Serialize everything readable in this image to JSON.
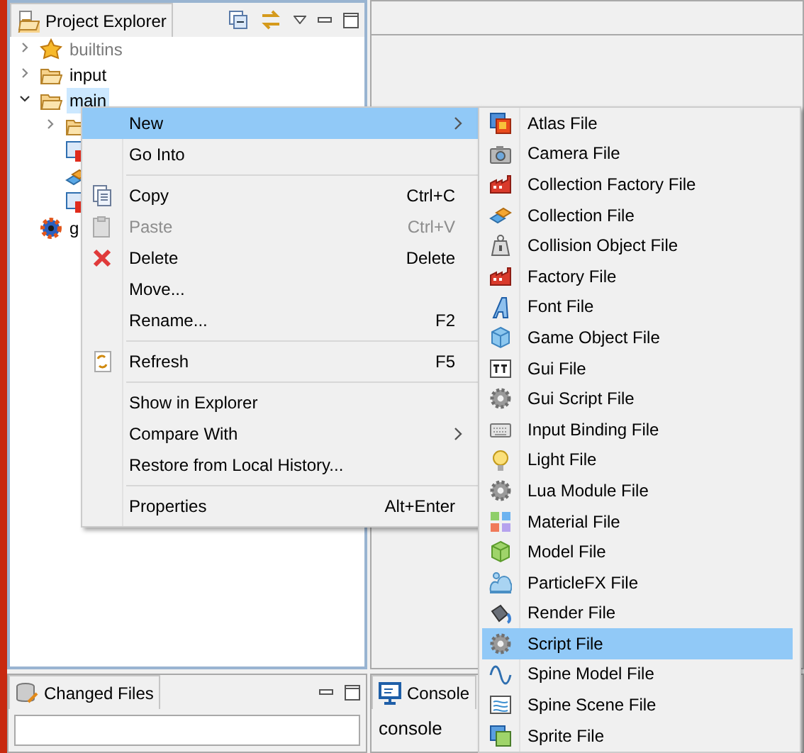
{
  "project_explorer": {
    "tab": {
      "label": "Project Explorer",
      "selected": true
    },
    "tree": [
      {
        "label": "builtins",
        "expanded": false,
        "selected": false,
        "dimmed": true
      },
      {
        "label": "input",
        "expanded": false,
        "selected": false
      },
      {
        "label": "main",
        "expanded": true,
        "selected": true,
        "children": [
          {
            "kind": "folder",
            "expanded": false
          },
          {
            "kind": "atlas"
          },
          {
            "kind": "collection"
          },
          {
            "kind": "atlas"
          }
        ]
      },
      {
        "label": "g",
        "selected": false
      }
    ]
  },
  "context_menu": {
    "items": [
      {
        "kind": "item",
        "label": "New",
        "submenu": true,
        "selected": true
      },
      {
        "kind": "item",
        "label": "Go Into"
      },
      {
        "kind": "separator"
      },
      {
        "kind": "item",
        "label": "Copy",
        "shortcut": "Ctrl+C"
      },
      {
        "kind": "item",
        "label": "Paste",
        "shortcut": "Ctrl+V",
        "disabled": true
      },
      {
        "kind": "item",
        "label": "Delete",
        "shortcut": "Delete"
      },
      {
        "kind": "item",
        "label": "Move..."
      },
      {
        "kind": "item",
        "label": "Rename...",
        "shortcut": "F2"
      },
      {
        "kind": "separator"
      },
      {
        "kind": "item",
        "label": "Refresh",
        "shortcut": "F5"
      },
      {
        "kind": "separator"
      },
      {
        "kind": "item",
        "label": "Show in Explorer"
      },
      {
        "kind": "item",
        "label": "Compare With",
        "submenu": true
      },
      {
        "kind": "item",
        "label": "Restore from Local History..."
      },
      {
        "kind": "separator"
      },
      {
        "kind": "item",
        "label": "Properties",
        "shortcut": "Alt+Enter"
      }
    ]
  },
  "new_submenu": {
    "items": [
      {
        "label": "Atlas File",
        "selected": false
      },
      {
        "label": "Camera File",
        "selected": false
      },
      {
        "label": "Collection Factory File",
        "selected": false
      },
      {
        "label": "Collection File",
        "selected": false
      },
      {
        "label": "Collision Object File",
        "selected": false
      },
      {
        "label": "Factory File",
        "selected": false
      },
      {
        "label": "Font File",
        "selected": false
      },
      {
        "label": "Game Object File",
        "selected": false
      },
      {
        "label": "Gui File",
        "selected": false
      },
      {
        "label": "Gui Script File",
        "selected": false
      },
      {
        "label": "Input Binding File",
        "selected": false
      },
      {
        "label": "Light File",
        "selected": false
      },
      {
        "label": "Lua Module File",
        "selected": false
      },
      {
        "label": "Material File",
        "selected": false
      },
      {
        "label": "Model File",
        "selected": false
      },
      {
        "label": "ParticleFX File",
        "selected": false
      },
      {
        "label": "Render File",
        "selected": false
      },
      {
        "label": "Script File",
        "selected": true
      },
      {
        "label": "Spine Model File",
        "selected": false
      },
      {
        "label": "Spine Scene File",
        "selected": false
      },
      {
        "label": "Sprite File",
        "selected": false
      }
    ]
  },
  "changed_files": {
    "tab": {
      "label": "Changed Files",
      "selected": true
    }
  },
  "console": {
    "tab": {
      "label": "Console",
      "selected": true
    },
    "text": "console"
  }
}
